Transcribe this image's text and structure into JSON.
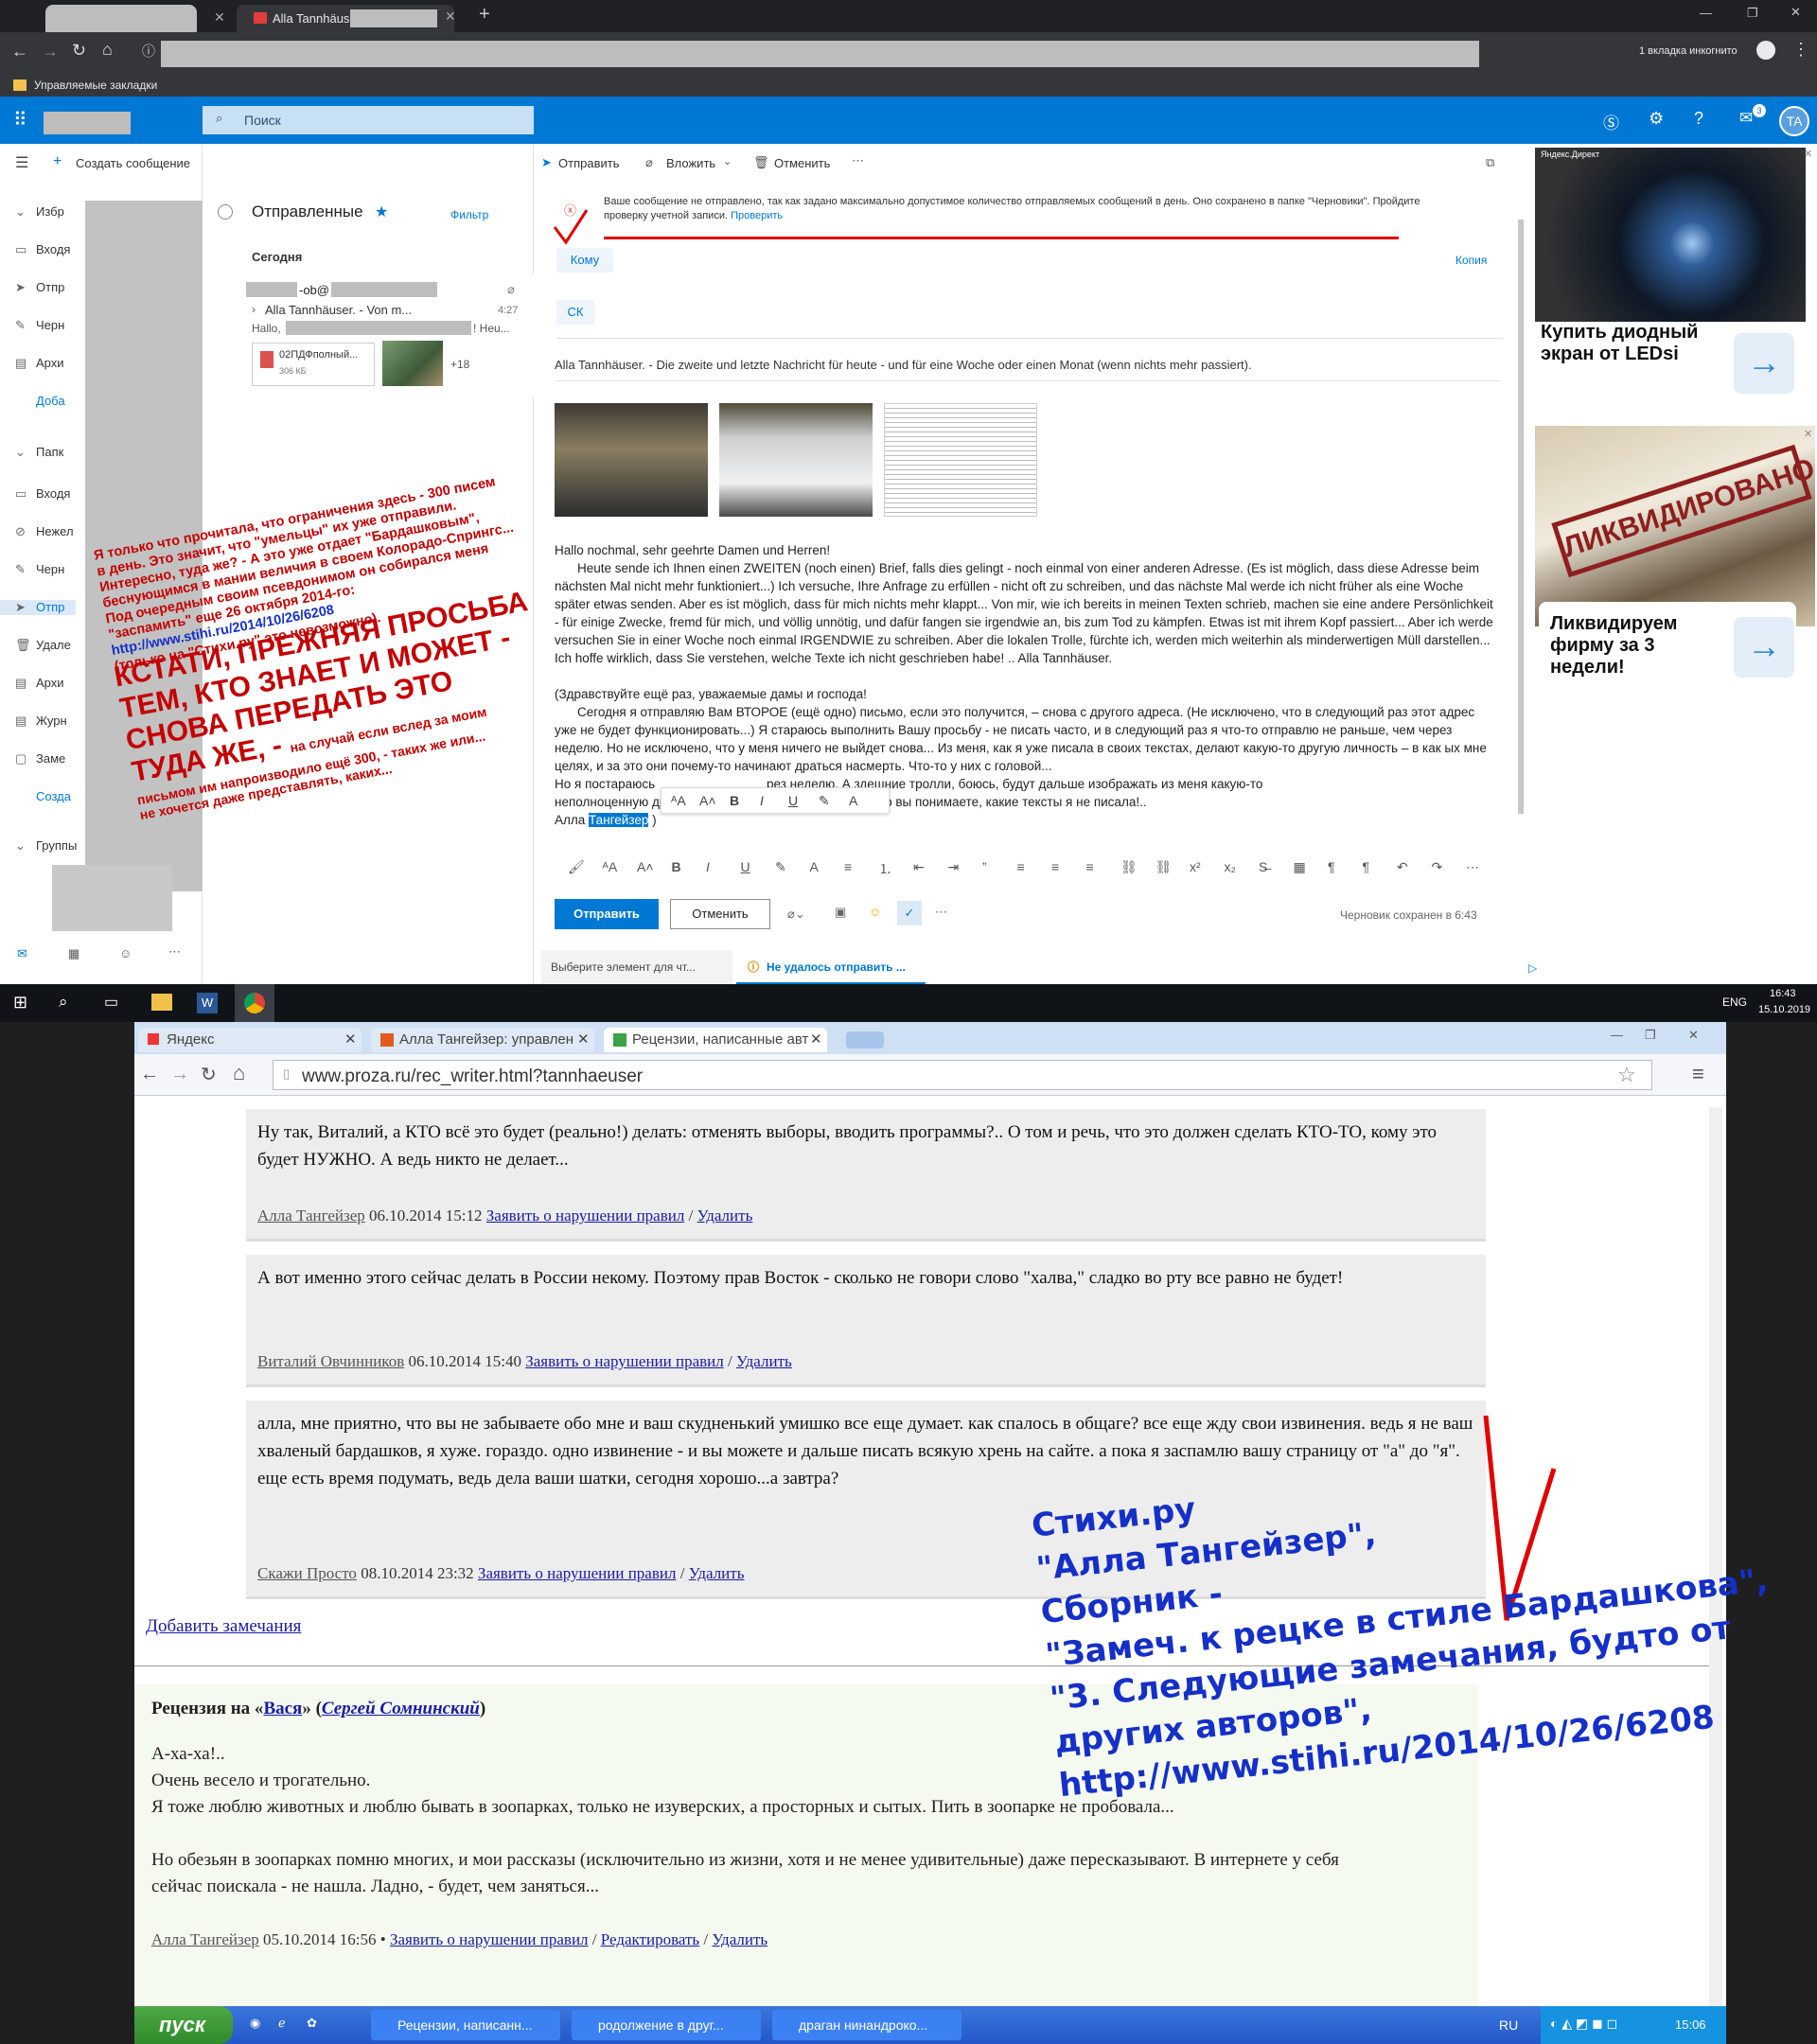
{
  "browser": {
    "tab2_title": "Alla Tannhäuser",
    "incognito": "1 вкладка инкогнито",
    "bookmarks": "Управляемые закладки"
  },
  "outlook": {
    "search_placeholder": "Поиск",
    "avatar": "TA",
    "notif_count": "3",
    "new_message": "Создать сообщение",
    "nav": [
      "Избр",
      "Входя",
      "Отпр",
      "Черн",
      "Архи",
      "Доба",
      "Папк",
      "Входя",
      "Нежел",
      "Черн",
      "Отпр",
      "Удале",
      "Архи",
      "Журн",
      "Заме",
      "Созда",
      "Группы"
    ],
    "folder_title": "Отправленные",
    "filter": "Фильтр",
    "today": "Сегодня",
    "msg_sender": "-ob@",
    "msg_subject": "Alla Tannhäuser. - Von m...",
    "msg_time": "4:27",
    "msg_preview_a": "Hallo,",
    "msg_preview_b": "! Heu...",
    "attach_name": "02ПДФполный...",
    "attach_size": "306 КБ",
    "attach_more": "+18",
    "actions": {
      "send": "Отправить",
      "attach": "Вложить",
      "discard": "Отменить"
    },
    "error_text": "Ваше сообщение не отправлено, так как задано максимально допустимое количество отправляемых сообщений в день. Оно сохранено в папке \"Черновики\". Пройдите проверку учетной записи.",
    "error_link": "Проверить",
    "to_label": "Кому",
    "cc_label": "Копия",
    "bcc_label": "СК",
    "subject": "Alla Tannhäuser. - Die zweite und letzte Nachricht für heute - und für eine Woche oder einen Monat (wenn nichts mehr passiert).",
    "body_de_1": "Hallo nochmal, sehr geehrte Damen und Herren!",
    "body_de_2": "Heute sende ich Ihnen einen ZWEITEN (noch einen) Brief, falls dies gelingt - noch einmal von einer anderen Adresse. (Es ist möglich, dass diese Adresse beim nächsten Mal nicht mehr funktioniert...) Ich versuche, Ihre Anfrage zu erfüllen - nicht oft zu schreiben, und das nächste Mal werde ich nicht früher als eine Woche später etwas senden. Aber es ist möglich, dass für mich nichts mehr klappt... Von mir, wie ich bereits in meinen Texten schrieb, machen sie eine andere Persönlichkeit - für einige Zwecke, fremd für mich, und völlig unnötig, und dafür fangen sie irgendwie an, bis zum Tod zu kämpfen. Etwas ist mit ihrem Kopf passiert... Aber ich werde versuchen Sie in einer Woche noch einmal IRGENDWIE zu schreiben. Aber die lokalen Trolle, fürchte ich, werden mich weiterhin als minderwertigen Müll darstellen... Ich hoffe wirklich, dass Sie verstehen, welche Texte ich nicht geschrieben habe! .. Alla Tannhäuser.",
    "body_ru_1": "(Здравствуйте ещё раз, уважаемые дамы и господа!",
    "body_ru_2": "Сегодня я отправляю Вам ВТОРОЕ (ещё одно) письмо, если это получится, – снова с другого адреса. (Не исключено, что в следующий раз этот адрес уже не будет функционировать...) Я стараюсь выполнить Вашу просьбу - не писать часто, и в следующий раз я что-то отправлю не раньше, чем через неделю. Но не исключено, что у меня ничего не выйдет снова... Из меня, как я уже писала в своих текстах, делают какую-то другую личность – в как",
    "body_ru_2b": "ых мне целях, и за это они почему-то начинают драться насмерть. Что-то у них с головой...",
    "body_ru_3a": "Но я постараюсь",
    "body_ru_3b": "рез неделю. А здешние тролли, боюсь, будут дальше изображать из меня какую-то",
    "body_ru_4a": "неполноценную дрянь",
    "body_ru_4b": "что вы понимаете, какие тексты я не писала!..",
    "sign_a": "Алла",
    "sign_b": "Тангейзер",
    "sign_c": ")",
    "send_btn": "Отправить",
    "discard_btn": "Отменить",
    "draft_saved": "Черновик сохранен в 6:43",
    "bottom_tab1": "Выберите элемент для чт...",
    "bottom_tab2": "Не удалось отправить ...",
    "ad_label": "Яндекс.Директ",
    "ad1": "Купить диодный экран от LEDsi",
    "ad2": "Ликвидируем фирму за 3 недели!",
    "ad2_stamp": "ЛИКВИДИРОВАНО"
  },
  "overlay_note": {
    "line1": "Я только что прочитала, что ограничения здесь - 300 писем",
    "line2": "в день. Это значит, что \"умельцы\" их уже отправили.",
    "line3": "Интересно, туда же? - А это уже отдает \"Бардашковым\",",
    "line4": "беснующимся в мании величия в своем Колорадо-Спрингс...",
    "line5": "Под очередным своим псевдонимом он собирался меня",
    "line6": "\"заспамить\" еще 26 октября 2014-го:",
    "line7": "http://www.stihi.ru/2014/10/26/6208",
    "line8": "(только на \"Стихи.ру\" это невозможно).",
    "big1": "КСТАТИ, ПРЕЖНЯЯ ПРОСЬБА",
    "big2": "ТЕМ, КТО ЗНАЕТ И МОЖЕТ -",
    "big3": "СНОВА ПЕРЕДАТЬ ЭТО",
    "big4": "ТУДА ЖЕ, -",
    "small1": "на случай если вслед за моим",
    "small2": "письмом им напроизводило ещё 300, - таких же или...",
    "small3": "не хочется даже представлять, каких..."
  },
  "taskbar": {
    "lang": "ENG",
    "time": "16:43",
    "date": "15.10.2019"
  },
  "lower": {
    "tabs": [
      "Яндекс",
      "Алла Тангейзер: управлен",
      "Рецензии, написанные авт"
    ],
    "url": "www.proza.ru/rec_writer.html?tannhaeuser",
    "reviews": [
      {
        "text": "Ну так, Виталий, а КТО всё это будет (реально!) делать: отменять выборы, вводить программы?.. О том и речь, что это должен сделать КТО-ТО, кому это будет НУЖНО. А ведь никто не делает...",
        "author": "Алла Тангейзер",
        "date": "06.10.2014 15:12"
      },
      {
        "text": "А вот именно этого сейчас делать в России некому. Поэтому прав Восток - сколько не говори слово \"халва,\" сладко во рту все равно не будет!",
        "author": "Виталий Овчинников",
        "date": "06.10.2014 15:40"
      },
      {
        "text": "алла, мне приятно, что вы не забываете обо мне и ваш скудненький умишко все еще думает. как спалось в общаге? все еще жду свои извинения. ведь я не ваш хваленый бардашков, я хуже. гораздо. одно извинение - и вы можете и дальше писать всякую хрень на сайте. а пока я заспамлю вашу страницу от \"а\" до \"я\". еще есть время подумать, ведь дела ваши шатки, сегодня хорошо...а завтра?",
        "author": "Скажи Просто",
        "date": "08.10.2014 23:32"
      }
    ],
    "report": "Заявить о нарушении правил",
    "delete": "Удалить",
    "add_remarks": "Добавить замечания",
    "rec_prefix": "Рецензия на «",
    "rec_work": "Вася",
    "rec_mid": "» (",
    "rec_author": "Сергей Сомнинский",
    "rec_suffix": ")",
    "rec_p1": "А-ха-ха!..",
    "rec_p2": "Очень весело и трогательно.",
    "rec_p3": "Я тоже люблю животных и люблю бывать в зоопарках, только не изуверских, а просторных и сытых. Пить в зоопарке не пробовала...",
    "rec_p4": "Но обезьян в зоопарках помню многих, и мои рассказы (исключительно из жизни, хотя и не менее удивительные) даже пересказывают. В интернете у себя сейчас поискала - не нашла. Ладно, - будет, чем заняться...",
    "rec_author2": "Алла Тангейзер",
    "rec_date": "05.10.2014 16:56",
    "edit": "Редактировать",
    "note1": "Стихи.ру",
    "note2": "\"Алла Тангейзер\",",
    "note3": "Сборник -",
    "note4": "\"Замеч. к рецке в стиле Бардашкова\",",
    "note5": "\"3. Следующие замечания, будто от",
    "note6": "других авторов\",",
    "note7": "http://www.stihi.ru/2014/10/26/6208",
    "xp_start": "пуск",
    "xp_tasks": [
      "Рецензии, написанн...",
      "родолжение в друг...",
      "драган нинандроко..."
    ],
    "xp_lang": "RU",
    "xp_time": "15:06"
  },
  "colors": {
    "outlook_blue": "#0078d4",
    "annotation_red": "#c40000",
    "annotation_blue": "#1530c8"
  }
}
